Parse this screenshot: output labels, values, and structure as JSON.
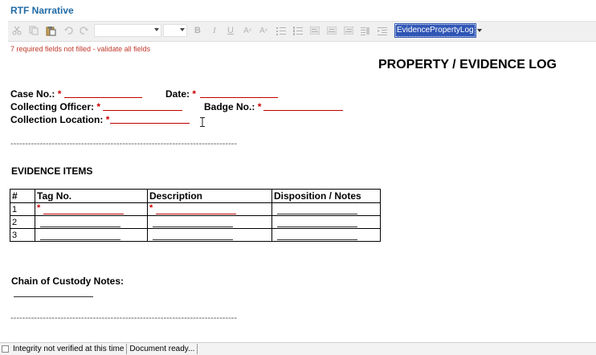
{
  "app": {
    "title": "RTF Narrative"
  },
  "toolbar": {
    "style_value": "EvidencePropertyLog",
    "icons": [
      "cut-icon",
      "copy-icon",
      "paste-icon",
      "undo-icon",
      "redo-icon",
      "bold-icon",
      "italic-icon",
      "underline-icon",
      "superscript-icon",
      "subscript-icon",
      "bullet-list-icon",
      "numbered-list-icon",
      "align-left-icon",
      "align-center-icon",
      "align-right-icon",
      "justify-icon",
      "indent-icon"
    ]
  },
  "validation": {
    "message": "7 required fields not filled - validate all fields"
  },
  "document": {
    "title": "PROPERTY / EVIDENCE LOG",
    "fields": {
      "case_no": "Case No.:",
      "date": "Date:",
      "collecting_officer": "Collecting Officer:",
      "badge_no": "Badge No.:",
      "collection_location": "Collection Location:"
    },
    "required_mark": "*",
    "separator": "-----------------------------------------------------------------------------",
    "evidence_heading": "EVIDENCE ITEMS",
    "table": {
      "headers": [
        "#",
        "Tag No.",
        "Description",
        "Disposition / Notes"
      ],
      "rows": [
        "1",
        "2",
        "3"
      ]
    },
    "chain_heading": "Chain of Custody Notes:"
  },
  "status": {
    "integrity": "Integrity not verified at this time",
    "document": "Document ready..."
  },
  "colors": {
    "title_blue": "#1f6aa5",
    "required_red": "#cc0000",
    "selection_blue": "#2f55b5"
  }
}
